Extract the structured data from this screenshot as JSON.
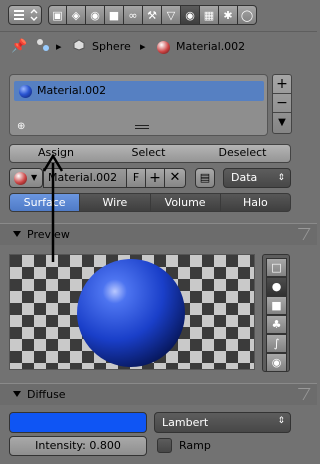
{
  "toolbar": {
    "icons": [
      "camera-icon",
      "scene-icon",
      "world-icon",
      "object-icon",
      "constraints-icon",
      "modifiers-icon",
      "data-icon",
      "material-icon",
      "texture-icon",
      "particles-icon",
      "physics-icon"
    ],
    "active_icon": "material-icon"
  },
  "breadcrumb": {
    "object": "Sphere",
    "material": "Material.002"
  },
  "material_slots": {
    "items": [
      "Material.002"
    ],
    "selected": "Material.002"
  },
  "slot_buttons": {
    "assign": "Assign",
    "select": "Select",
    "deselect": "Deselect"
  },
  "material_datablock": {
    "name": "Material.002",
    "fake_user": "F",
    "link": "Data"
  },
  "surface_tabs": {
    "items": [
      "Surface",
      "Wire",
      "Volume",
      "Halo"
    ],
    "active": "Surface"
  },
  "preview": {
    "title": "Preview"
  },
  "diffuse": {
    "title": "Diffuse",
    "shader": "Lambert",
    "intensity_label": "Intensity: 0.800",
    "ramp_label": "Ramp",
    "color": "#0f55f4"
  }
}
